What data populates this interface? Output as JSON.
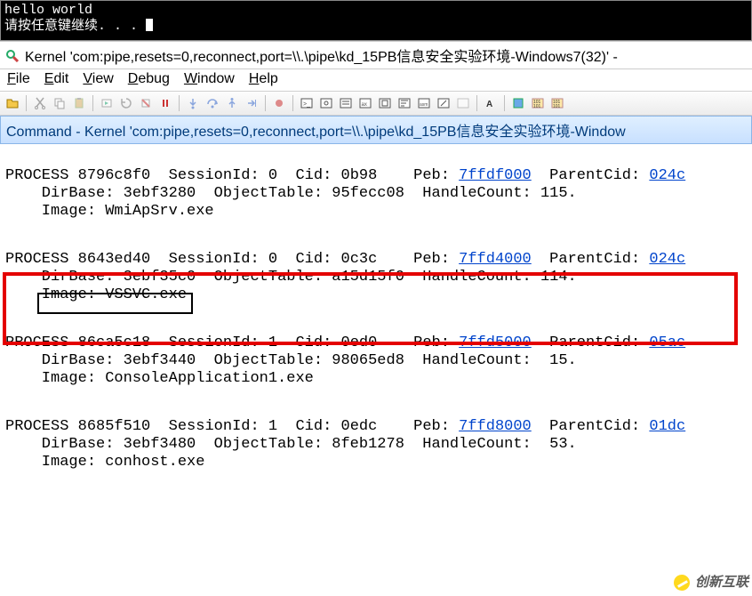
{
  "console": {
    "line1": "hello world",
    "line2": "请按任意键继续. . . "
  },
  "wb_title": "Kernel 'com:pipe,resets=0,reconnect,port=\\\\.\\pipe\\kd_15PB信息安全实验环境-Windows7(32)' - ",
  "menu": {
    "file": "File",
    "edit": "Edit",
    "view": "View",
    "debug": "Debug",
    "window": "Window",
    "help": "Help"
  },
  "cmd_title": "Command - Kernel 'com:pipe,resets=0,reconnect,port=\\\\.\\pipe\\kd_15PB信息安全实验环境-Window",
  "processes": [
    {
      "addr": "8796c8f0",
      "session": "0",
      "cid": "0b98",
      "peb": "7ffdf000",
      "parent": "024c",
      "dirbase": "3ebf3280",
      "objtab": "95fecc08",
      "handles": "115",
      "image": "WmiApSrv.exe"
    },
    {
      "addr": "8643ed40",
      "session": "0",
      "cid": "0c3c",
      "peb": "7ffd4000",
      "parent": "024c",
      "dirbase": "3ebf35c0",
      "objtab": "a15d15f0",
      "handles": "114",
      "image": "VSSVC.exe"
    },
    {
      "addr": "86ca5c18",
      "session": "1",
      "cid": "0ed0",
      "peb": "7ffd5000",
      "parent": "05ac",
      "dirbase": "3ebf3440",
      "objtab": "98065ed8",
      "handles": "15",
      "image": "ConsoleApplication1.exe"
    },
    {
      "addr": "8685f510",
      "session": "1",
      "cid": "0edc",
      "peb": "7ffd8000",
      "parent": "01dc",
      "dirbase": "3ebf3480",
      "objtab": "8feb1278",
      "handles": "53",
      "image": "conhost.exe"
    }
  ],
  "labels": {
    "process": "PROCESS ",
    "session": "  SessionId: ",
    "cid": "  Cid: ",
    "peb": "    Peb: ",
    "parent": "  ParentCid: ",
    "dirbase": "    DirBase: ",
    "objtab": "  ObjectTable: ",
    "handles": "  HandleCount:",
    "image": "    Image: "
  },
  "watermark": "创新互联"
}
